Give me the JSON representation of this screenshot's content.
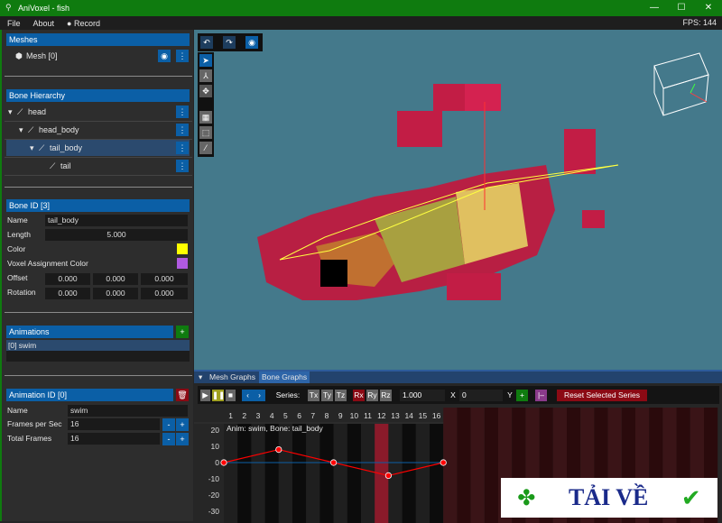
{
  "window": {
    "title": "AniVoxel - fish",
    "minimize": "—",
    "maximize": "☐",
    "close": "✕"
  },
  "menu": {
    "items": [
      "File",
      "About",
      "Record"
    ],
    "fps": "FPS: 144"
  },
  "meshes": {
    "header": "Meshes",
    "items": [
      {
        "label": "Mesh [0]"
      }
    ]
  },
  "bones": {
    "header": "Bone Hierarchy",
    "items": [
      {
        "label": "head",
        "depth": 0,
        "expanded": true
      },
      {
        "label": "head_body",
        "depth": 1,
        "expanded": true
      },
      {
        "label": "tail_body",
        "depth": 2,
        "expanded": true,
        "selected": true
      },
      {
        "label": "tail",
        "depth": 3,
        "expanded": false
      }
    ]
  },
  "bone_props": {
    "header": "Bone ID [3]",
    "name_label": "Name",
    "name": "tail_body",
    "length_label": "Length",
    "length": "5.000",
    "color_label": "Color",
    "color": "#ffff00",
    "vac_label": "Voxel Assignment Color",
    "vac": "#b05ae0",
    "offset_label": "Offset",
    "offset": [
      "0.000",
      "0.000",
      "0.000"
    ],
    "rotation_label": "Rotation",
    "rotation": [
      "0.000",
      "0.000",
      "0.000"
    ]
  },
  "animations": {
    "header": "Animations",
    "add": "+",
    "items": [
      "[0] swim"
    ]
  },
  "anim_props": {
    "header": "Animation ID [0]",
    "name_label": "Name",
    "name": "swim",
    "fps_label": "Frames per Sec",
    "fps": "16",
    "frames_label": "Total Frames",
    "frames": "16",
    "minus": "-",
    "plus": "+"
  },
  "graph": {
    "tabs": [
      "Mesh Graphs",
      "Bone Graphs"
    ],
    "active_tab": "Bone Graphs",
    "series_label": "Series:",
    "series_t": [
      "Tx",
      "Ty",
      "Tz"
    ],
    "series_r": [
      "Rx",
      "Ry",
      "Rz"
    ],
    "selected_series": "Rx",
    "x_value": "1.000",
    "x_label": "X",
    "y_value": "0",
    "y_label": "Y",
    "add": "+",
    "reset": "Reset Selected Series",
    "caption": "Anim: swim, Bone: tail_body",
    "frames": [
      "1",
      "2",
      "3",
      "4",
      "5",
      "6",
      "7",
      "8",
      "9",
      "10",
      "11",
      "12",
      "13",
      "14",
      "15",
      "16"
    ],
    "current_frame": 12,
    "y_ticks": [
      "20",
      "10",
      "0",
      "-10",
      "-20",
      "-30"
    ],
    "keyframes": [
      {
        "frame": 0,
        "value": 0
      },
      {
        "frame": 4,
        "value": 8
      },
      {
        "frame": 8,
        "value": 0
      },
      {
        "frame": 12,
        "value": -8
      },
      {
        "frame": 16,
        "value": 0
      }
    ],
    "line_color": "#ff0000",
    "accent": "#0b5fa6"
  },
  "watermark": {
    "text": "TẢI VỀ"
  }
}
